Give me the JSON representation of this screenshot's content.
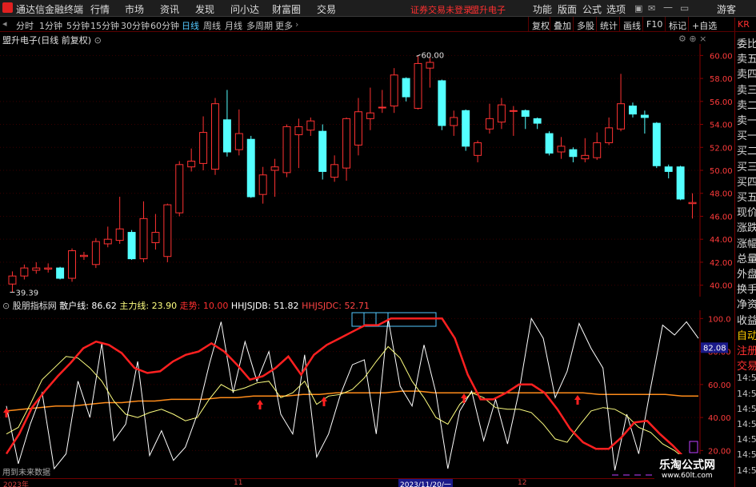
{
  "menu": {
    "app_title": "通达信金融终端",
    "items": [
      "行情",
      "市场",
      "资讯",
      "发现",
      "问小达",
      "财富圈",
      "交易"
    ],
    "status": "证券交易未登录",
    "stock": "盟升电子",
    "right_items": [
      "功能",
      "版面",
      "公式",
      "选项"
    ],
    "guest": "游客"
  },
  "toolbar": {
    "periods": [
      "分时",
      "1分钟",
      "5分钟",
      "15分钟",
      "30分钟",
      "60分钟",
      "日线",
      "周线",
      "月线",
      "多周期",
      "更多"
    ],
    "active_period": "日线",
    "right_items": [
      "复权",
      "叠加",
      "多股",
      "统计",
      "画线",
      "F10",
      "标记",
      "+自选"
    ],
    "back_btn": "返回"
  },
  "chart_header": {
    "title": "盟升电子(日线 前复权)"
  },
  "sidebar_items": [
    "委比",
    "卖五",
    "卖四",
    "卖三",
    "卖二",
    "卖一",
    "买一",
    "买二",
    "买三",
    "买四",
    "买五",
    "现价",
    "涨跌",
    "涨幅",
    "总量",
    "外盘",
    "换手",
    "净资",
    "收益",
    "自动",
    "注册",
    "交易",
    "14:55",
    "14:55",
    "14:56",
    "14:56",
    "14:56",
    "14:56",
    "14:56"
  ],
  "watermark": {
    "text": "乐淘公式网",
    "url": "www.60lt.com"
  },
  "chart_data": [
    {
      "type": "candlestick",
      "title": "盟升电子(日线 前复权)",
      "ylim": [
        39,
        61
      ],
      "yticks": [
        40,
        42,
        44,
        46,
        48,
        50,
        52,
        54,
        56,
        58,
        60
      ],
      "ytick_labels": [
        "40.00",
        "42.00",
        "44.00",
        "46.00",
        "48.00",
        "50.00",
        "52.00",
        "54.00",
        "56.00",
        "58.00",
        "60.00"
      ],
      "annotations": [
        {
          "label": "60.00",
          "type": "high"
        },
        {
          "label": "39.39",
          "type": "low"
        }
      ],
      "up_color": "#ff3232",
      "down_color": "#54ffff",
      "candles": [
        {
          "o": 40.1,
          "c": 40.8,
          "h": 41.2,
          "l": 39.39
        },
        {
          "o": 40.8,
          "c": 41.5,
          "h": 41.8,
          "l": 40.5
        },
        {
          "o": 41.3,
          "c": 41.5,
          "h": 42.0,
          "l": 41.0
        },
        {
          "o": 41.4,
          "c": 41.5,
          "h": 41.9,
          "l": 41.1
        },
        {
          "o": 41.5,
          "c": 40.6,
          "h": 41.6,
          "l": 40.5
        },
        {
          "o": 40.6,
          "c": 43.0,
          "h": 43.2,
          "l": 40.3
        },
        {
          "o": 42.5,
          "c": 42.6,
          "h": 42.9,
          "l": 42.2
        },
        {
          "o": 41.8,
          "c": 43.8,
          "h": 44.1,
          "l": 41.5
        },
        {
          "o": 43.6,
          "c": 44.0,
          "h": 45.1,
          "l": 43.3
        },
        {
          "o": 43.9,
          "c": 44.9,
          "h": 47.7,
          "l": 43.6
        },
        {
          "o": 44.6,
          "c": 42.3,
          "h": 44.8,
          "l": 42.2
        },
        {
          "o": 42.3,
          "c": 45.8,
          "h": 47.3,
          "l": 42.0
        },
        {
          "o": 43.7,
          "c": 44.6,
          "h": 46.2,
          "l": 43.1
        },
        {
          "o": 42.5,
          "c": 47.0,
          "h": 47.1,
          "l": 42.0
        },
        {
          "o": 46.3,
          "c": 50.5,
          "h": 50.8,
          "l": 46.0
        },
        {
          "o": 50.3,
          "c": 50.8,
          "h": 51.9,
          "l": 49.9
        },
        {
          "o": 50.6,
          "c": 53.3,
          "h": 54.7,
          "l": 50.0
        },
        {
          "o": 50.1,
          "c": 55.8,
          "h": 56.3,
          "l": 49.6
        },
        {
          "o": 54.4,
          "c": 51.6,
          "h": 57.0,
          "l": 51.2
        },
        {
          "o": 51.8,
          "c": 53.2,
          "h": 55.3,
          "l": 51.3
        },
        {
          "o": 52.7,
          "c": 47.7,
          "h": 53.0,
          "l": 47.6
        },
        {
          "o": 47.9,
          "c": 49.6,
          "h": 50.3,
          "l": 47.1
        },
        {
          "o": 50.0,
          "c": 50.3,
          "h": 51.0,
          "l": 47.7
        },
        {
          "o": 49.8,
          "c": 53.8,
          "h": 54.0,
          "l": 49.4
        },
        {
          "o": 53.1,
          "c": 53.8,
          "h": 54.5,
          "l": 50.2
        },
        {
          "o": 53.5,
          "c": 54.3,
          "h": 54.6,
          "l": 53.0
        },
        {
          "o": 53.4,
          "c": 49.9,
          "h": 54.0,
          "l": 49.2
        },
        {
          "o": 49.4,
          "c": 50.5,
          "h": 51.3,
          "l": 49.0
        },
        {
          "o": 50.2,
          "c": 54.5,
          "h": 54.6,
          "l": 49.1
        },
        {
          "o": 52.2,
          "c": 55.1,
          "h": 56.3,
          "l": 51.3
        },
        {
          "o": 54.5,
          "c": 55.0,
          "h": 57.2,
          "l": 53.5
        },
        {
          "o": 55.5,
          "c": 55.5,
          "h": 57.0,
          "l": 55.0
        },
        {
          "o": 55.6,
          "c": 58.3,
          "h": 58.9,
          "l": 55.0
        },
        {
          "o": 58.0,
          "c": 56.4,
          "h": 58.1,
          "l": 56.0
        },
        {
          "o": 55.4,
          "c": 59.3,
          "h": 60.0,
          "l": 55.3
        },
        {
          "o": 58.9,
          "c": 59.4,
          "h": 59.8,
          "l": 57.2
        },
        {
          "o": 57.8,
          "c": 53.9,
          "h": 57.9,
          "l": 53.5
        },
        {
          "o": 53.9,
          "c": 54.6,
          "h": 55.2,
          "l": 53.0
        },
        {
          "o": 55.2,
          "c": 52.1,
          "h": 55.3,
          "l": 51.7
        },
        {
          "o": 51.3,
          "c": 52.4,
          "h": 52.6,
          "l": 50.7
        },
        {
          "o": 53.6,
          "c": 54.5,
          "h": 55.8,
          "l": 53.2
        },
        {
          "o": 54.2,
          "c": 55.7,
          "h": 56.3,
          "l": 53.6
        },
        {
          "o": 55.2,
          "c": 55.2,
          "h": 55.6,
          "l": 53.0
        },
        {
          "o": 55.2,
          "c": 54.7,
          "h": 55.3,
          "l": 53.6
        },
        {
          "o": 54.5,
          "c": 54.1,
          "h": 54.6,
          "l": 53.6
        },
        {
          "o": 53.2,
          "c": 51.5,
          "h": 53.4,
          "l": 51.3
        },
        {
          "o": 51.6,
          "c": 52.1,
          "h": 52.9,
          "l": 51.0
        },
        {
          "o": 51.8,
          "c": 51.2,
          "h": 52.0,
          "l": 50.7
        },
        {
          "o": 51.0,
          "c": 51.3,
          "h": 52.8,
          "l": 50.7
        },
        {
          "o": 51.1,
          "c": 52.4,
          "h": 53.3,
          "l": 50.9
        },
        {
          "o": 52.4,
          "c": 53.7,
          "h": 54.6,
          "l": 52.2
        },
        {
          "o": 53.6,
          "c": 55.8,
          "h": 58.4,
          "l": 53.4
        },
        {
          "o": 55.6,
          "c": 54.9,
          "h": 55.9,
          "l": 54.6
        },
        {
          "o": 54.8,
          "c": 54.6,
          "h": 55.2,
          "l": 53.2
        },
        {
          "o": 54.1,
          "c": 50.4,
          "h": 54.2,
          "l": 50.2
        },
        {
          "o": 50.3,
          "c": 49.9,
          "h": 50.5,
          "l": 49.3
        },
        {
          "o": 50.3,
          "c": 47.5,
          "h": 50.4,
          "l": 47.4
        },
        {
          "o": 47.1,
          "c": 47.2,
          "h": 48.0,
          "l": 45.8
        }
      ]
    },
    {
      "type": "line",
      "title": "股朋指标网",
      "ylim": [
        10,
        105
      ],
      "yticks": [
        20,
        40,
        60,
        80,
        100
      ],
      "ytick_labels": [
        "20.00",
        "40.00",
        "60.00",
        "80.00",
        "100.0"
      ],
      "current_value_label": "82.08",
      "series": [
        {
          "name": "散户线",
          "value_label": "86.62",
          "color": "#ffffff",
          "values": [
            47,
            12,
            36,
            55,
            9,
            18,
            62,
            40,
            85,
            26,
            36,
            74,
            17,
            32,
            14,
            22,
            42,
            72,
            98,
            55,
            86,
            62,
            80,
            42,
            30,
            78,
            16,
            30,
            54,
            72,
            75,
            30,
            100,
            59,
            47,
            84,
            55,
            9,
            44,
            56,
            26,
            51,
            24,
            57,
            100,
            88,
            52,
            68,
            97,
            82,
            70,
            8,
            42,
            18,
            58,
            96,
            90,
            98,
            88
          ]
        },
        {
          "name": "主力线",
          "value_label": "23.90",
          "color": "#ffff80",
          "values": [
            30,
            34,
            48,
            63,
            70,
            77,
            76,
            70,
            62,
            50,
            42,
            40,
            43,
            45,
            42,
            38,
            40,
            51,
            60,
            56,
            58,
            61,
            62,
            52,
            55,
            62,
            48,
            53,
            54,
            57,
            64,
            74,
            83,
            76,
            62,
            52,
            40,
            36,
            48,
            55,
            52,
            46,
            45,
            45,
            43,
            36,
            27,
            25,
            35,
            44,
            46,
            45,
            41,
            34,
            31,
            24,
            20,
            14,
            12
          ]
        },
        {
          "name": "走势",
          "value_label": "10.00",
          "color": "#ff2020",
          "values": [
            18,
            30,
            46,
            56,
            65,
            73,
            82,
            86,
            84,
            79,
            70,
            67,
            68,
            74,
            78,
            80,
            85,
            80,
            72,
            63,
            65,
            70,
            77,
            66,
            78,
            84,
            88,
            92,
            96,
            96,
            100,
            100,
            100,
            100,
            100,
            88,
            66,
            51,
            51,
            55,
            60,
            60,
            55,
            45,
            33,
            25,
            21,
            21,
            28,
            37,
            38,
            30,
            23,
            15,
            12
          ]
        },
        {
          "name": "HHJSJDB",
          "value_label": "51.82",
          "color": "#ffffff",
          "values": []
        },
        {
          "name": "HHJSJDC",
          "value_label": "52.71",
          "color": "#ff4444",
          "values": []
        },
        {
          "name": "MA",
          "color": "#ff8c1a",
          "values": [
            44,
            45,
            46,
            47,
            47,
            48,
            49,
            49,
            50,
            50,
            51,
            51,
            51,
            52,
            52,
            53,
            53,
            53,
            54,
            54,
            55,
            55,
            55,
            55,
            56,
            56,
            55,
            55,
            55,
            55,
            55,
            55,
            55,
            55,
            55,
            55,
            54,
            54,
            54,
            54,
            54,
            53,
            53
          ]
        }
      ],
      "up_arrows_idx": [
        0,
        19,
        24,
        34,
        43
      ]
    }
  ],
  "xaxis": {
    "labels": [
      "2023年",
      "11",
      "2023/11/20/一",
      "12"
    ]
  },
  "footer_note": "用到未来数据"
}
